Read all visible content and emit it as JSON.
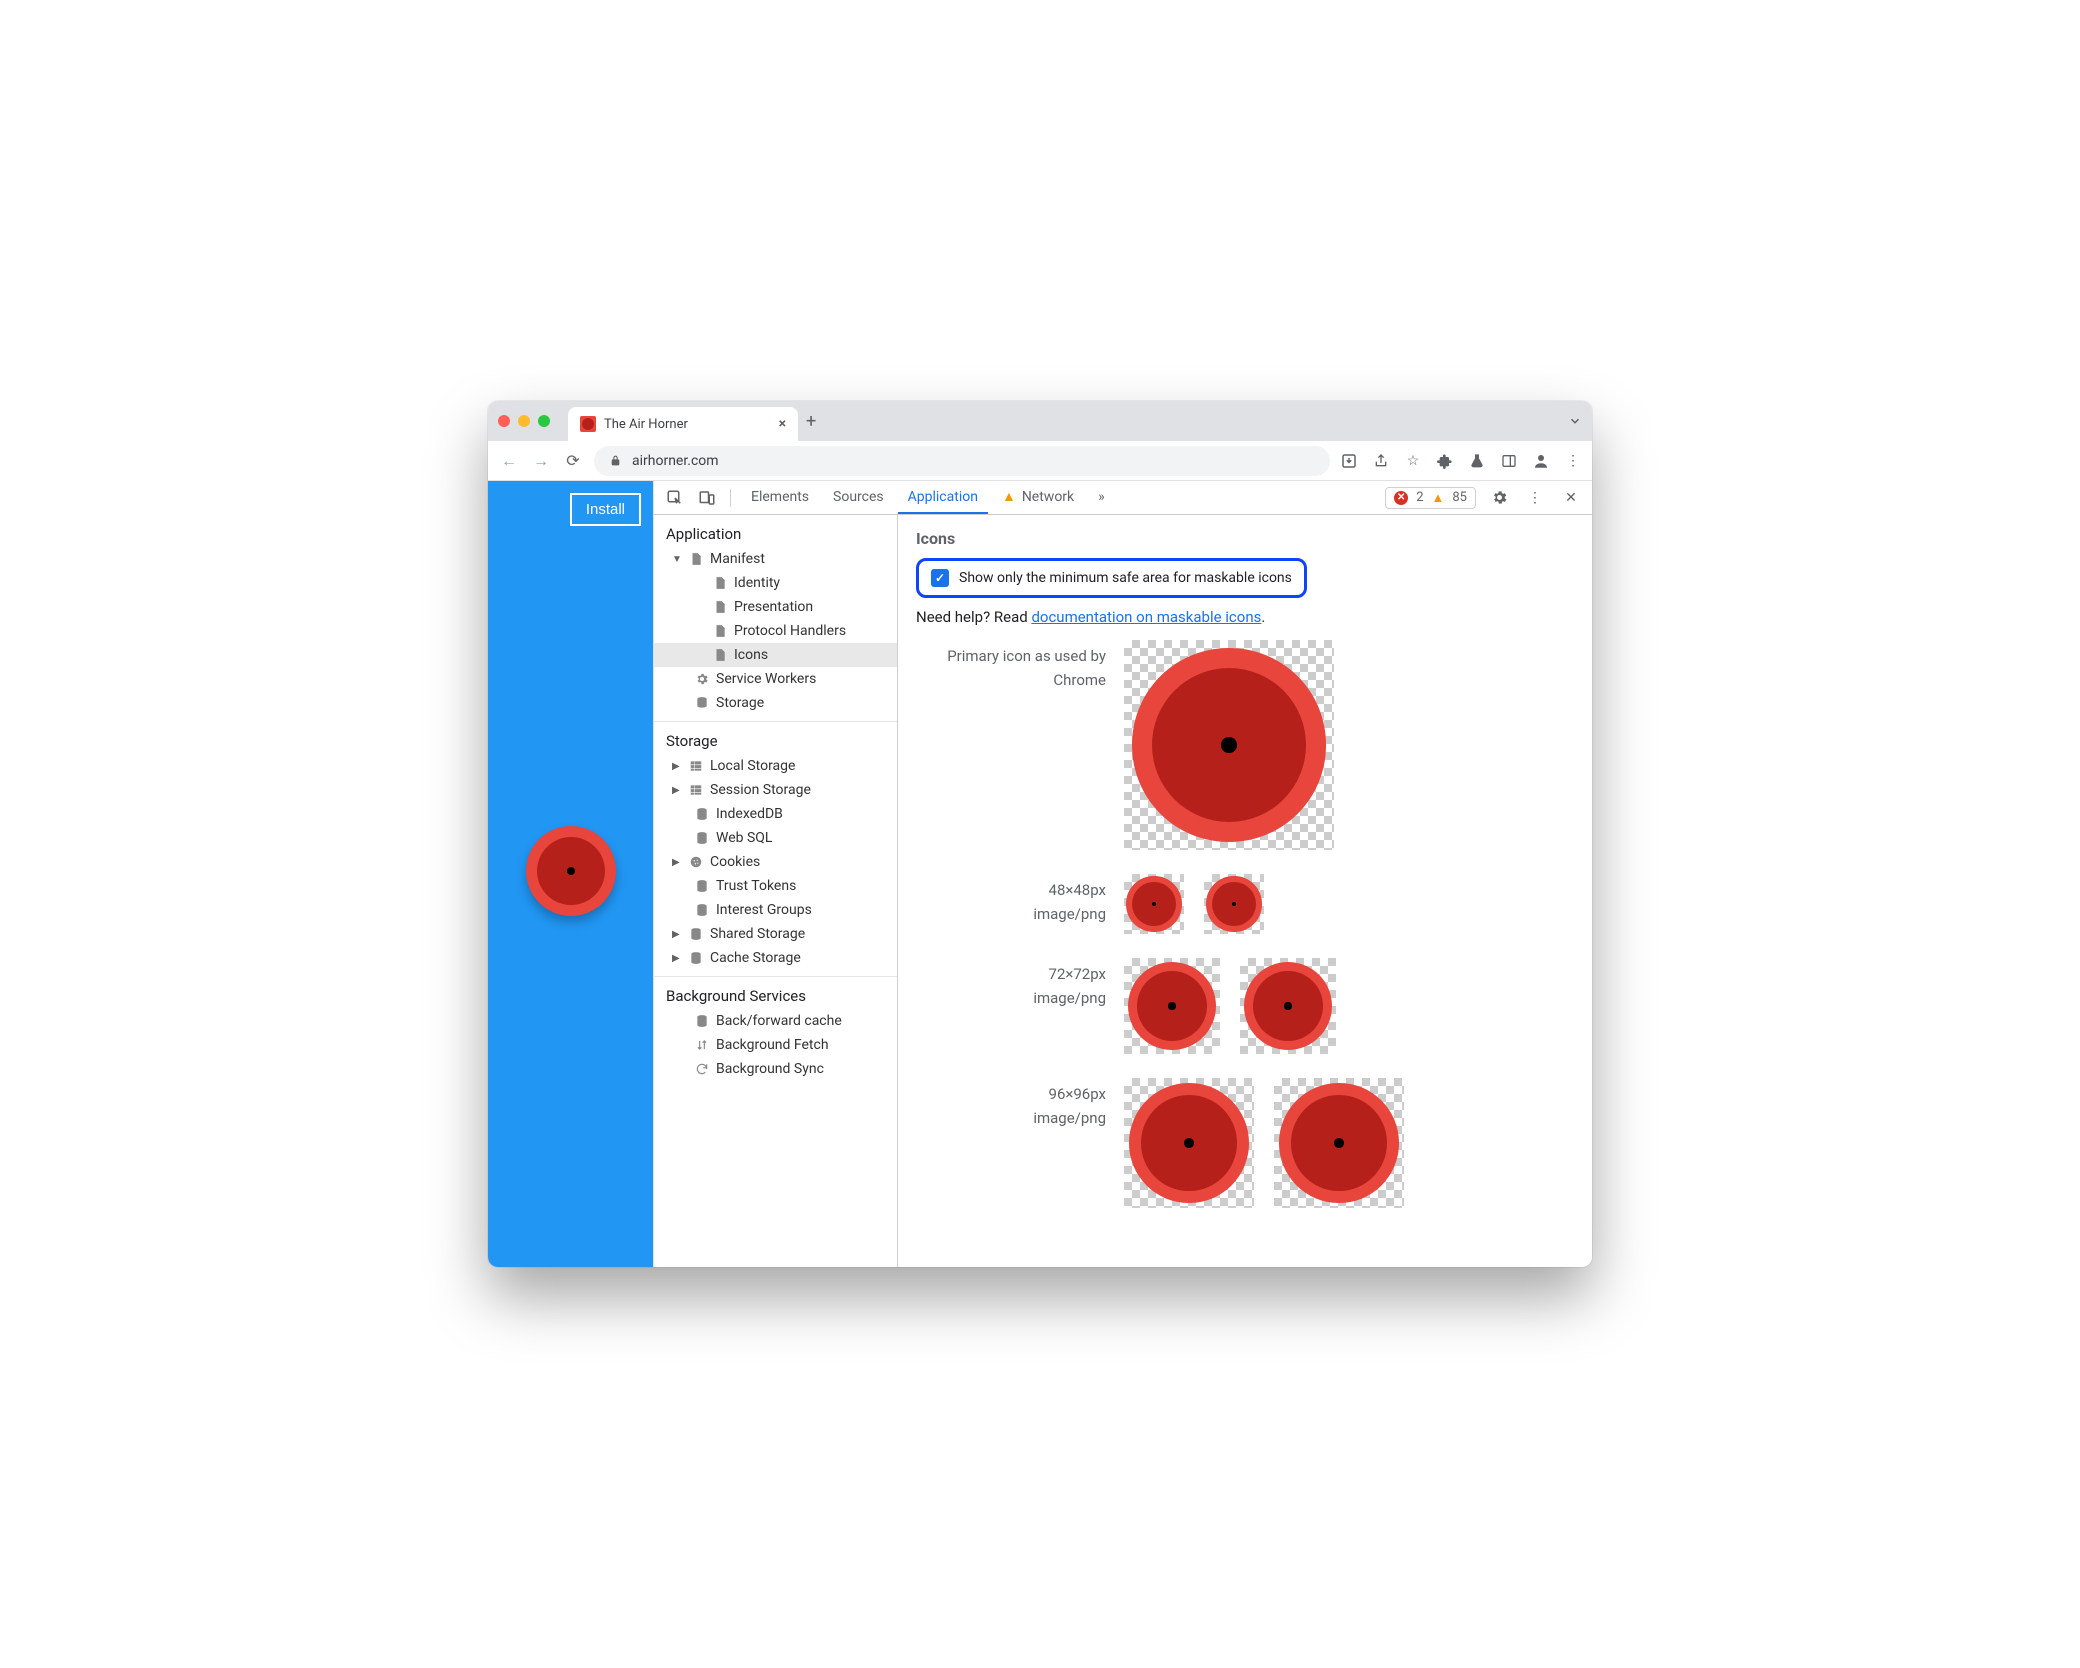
{
  "tab": {
    "title": "The Air Horner"
  },
  "address": {
    "url": "airhorner.com"
  },
  "page": {
    "install_label": "Install"
  },
  "devtools": {
    "tabs": {
      "elements": "Elements",
      "sources": "Sources",
      "application": "Application",
      "network": "Network"
    },
    "counts": {
      "errors": "2",
      "warnings": "85"
    }
  },
  "sidebar": {
    "sections": {
      "application": "Application",
      "storage": "Storage",
      "background": "Background Services"
    },
    "app": {
      "manifest": "Manifest",
      "identity": "Identity",
      "presentation": "Presentation",
      "protocol_handlers": "Protocol Handlers",
      "icons": "Icons",
      "service_workers": "Service Workers",
      "storage": "Storage"
    },
    "storage": {
      "local": "Local Storage",
      "session": "Session Storage",
      "indexeddb": "IndexedDB",
      "websql": "Web SQL",
      "cookies": "Cookies",
      "trust": "Trust Tokens",
      "interest": "Interest Groups",
      "shared": "Shared Storage",
      "cache": "Cache Storage"
    },
    "bg": {
      "bfcache": "Back/forward cache",
      "bgfetch": "Background Fetch",
      "bgsync": "Background Sync"
    }
  },
  "main": {
    "title": "Icons",
    "checkbox_label": "Show only the minimum safe area for maskable icons",
    "help_prefix": "Need help? Read ",
    "help_link": "documentation on maskable icons",
    "primary_label_l1": "Primary icon as used by",
    "primary_label_l2": "Chrome",
    "rows": {
      "r48": {
        "size": "48×48px",
        "type": "image/png"
      },
      "r72": {
        "size": "72×72px",
        "type": "image/png"
      },
      "r96": {
        "size": "96×96px",
        "type": "image/png"
      }
    }
  }
}
